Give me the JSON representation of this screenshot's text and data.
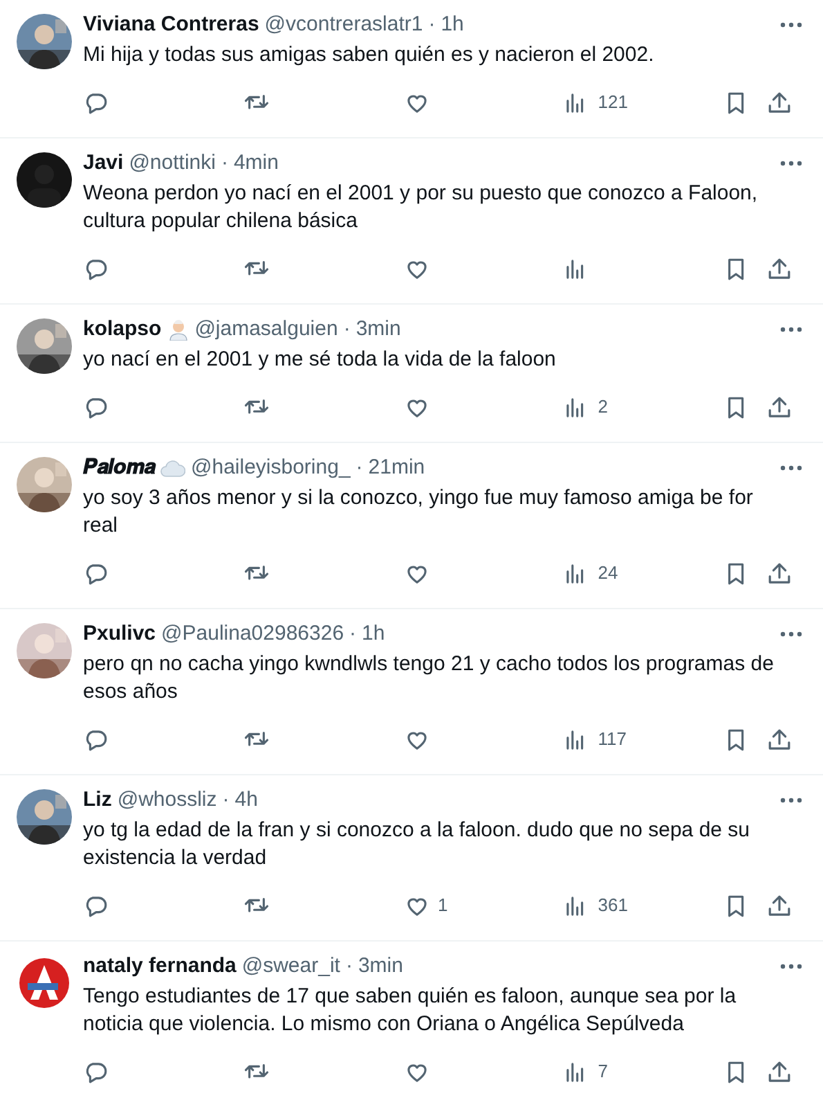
{
  "tweets": [
    {
      "name": "Viviana Contreras",
      "handle": "@vcontreraslatr1",
      "separator": "·",
      "time": "1h",
      "text": "Mi hija y todas sus amigas saben quién es y nacieron el 2002.",
      "views": "121"
    },
    {
      "avatar": {
        "kind": "dark"
      },
      "name": "Javi",
      "handle": "@nottinki",
      "separator": "·",
      "time": "4min",
      "text": "Weona perdon yo nací en el 2001 y por su puesto que conozco a Faloon, cultura popular chilena básica"
    },
    {
      "name": "kolapso",
      "name_icon": {
        "kind": "person"
      },
      "handle": "@jamasalguien",
      "separator": "·",
      "time": "3min",
      "text": "yo nací en el 2001 y me sé toda la vida de la faloon",
      "views": "2"
    },
    {
      "name": "𝑷𝒂𝒍𝒐𝒎𝒂",
      "name_icon": {
        "kind": "cloud"
      },
      "handle": "@haileyisboring_",
      "separator": "·",
      "time": "21min",
      "text": "yo soy 3 años menor y si la conozco, yingo fue muy famoso amiga be for real",
      "views": "24"
    },
    {
      "name": "Pxulivc",
      "handle": "@Paulina02986326",
      "separator": "·",
      "time": "1h",
      "text": "pero qn no cacha yingo kwndlwls tengo 21 y cacho todos los programas de esos años",
      "views": "117"
    },
    {
      "name": "Liz",
      "handle": "@whossliz",
      "separator": "·",
      "time": "4h",
      "text": "yo tg la edad de la fran y si conozco a la faloon. dudo que no sepa de su existencia la verdad",
      "likes": "1",
      "views": "361"
    },
    {
      "avatar": {
        "kind": "logo"
      },
      "name": "nataly fernanda",
      "handle": "@swear_it",
      "separator": "·",
      "time": "3min",
      "text": "Tengo estudiantes de 17 que saben quién es faloon, aunque sea por la noticia que violencia. Lo mismo con Oriana o Angélica Sepúlveda",
      "views": "7"
    }
  ]
}
